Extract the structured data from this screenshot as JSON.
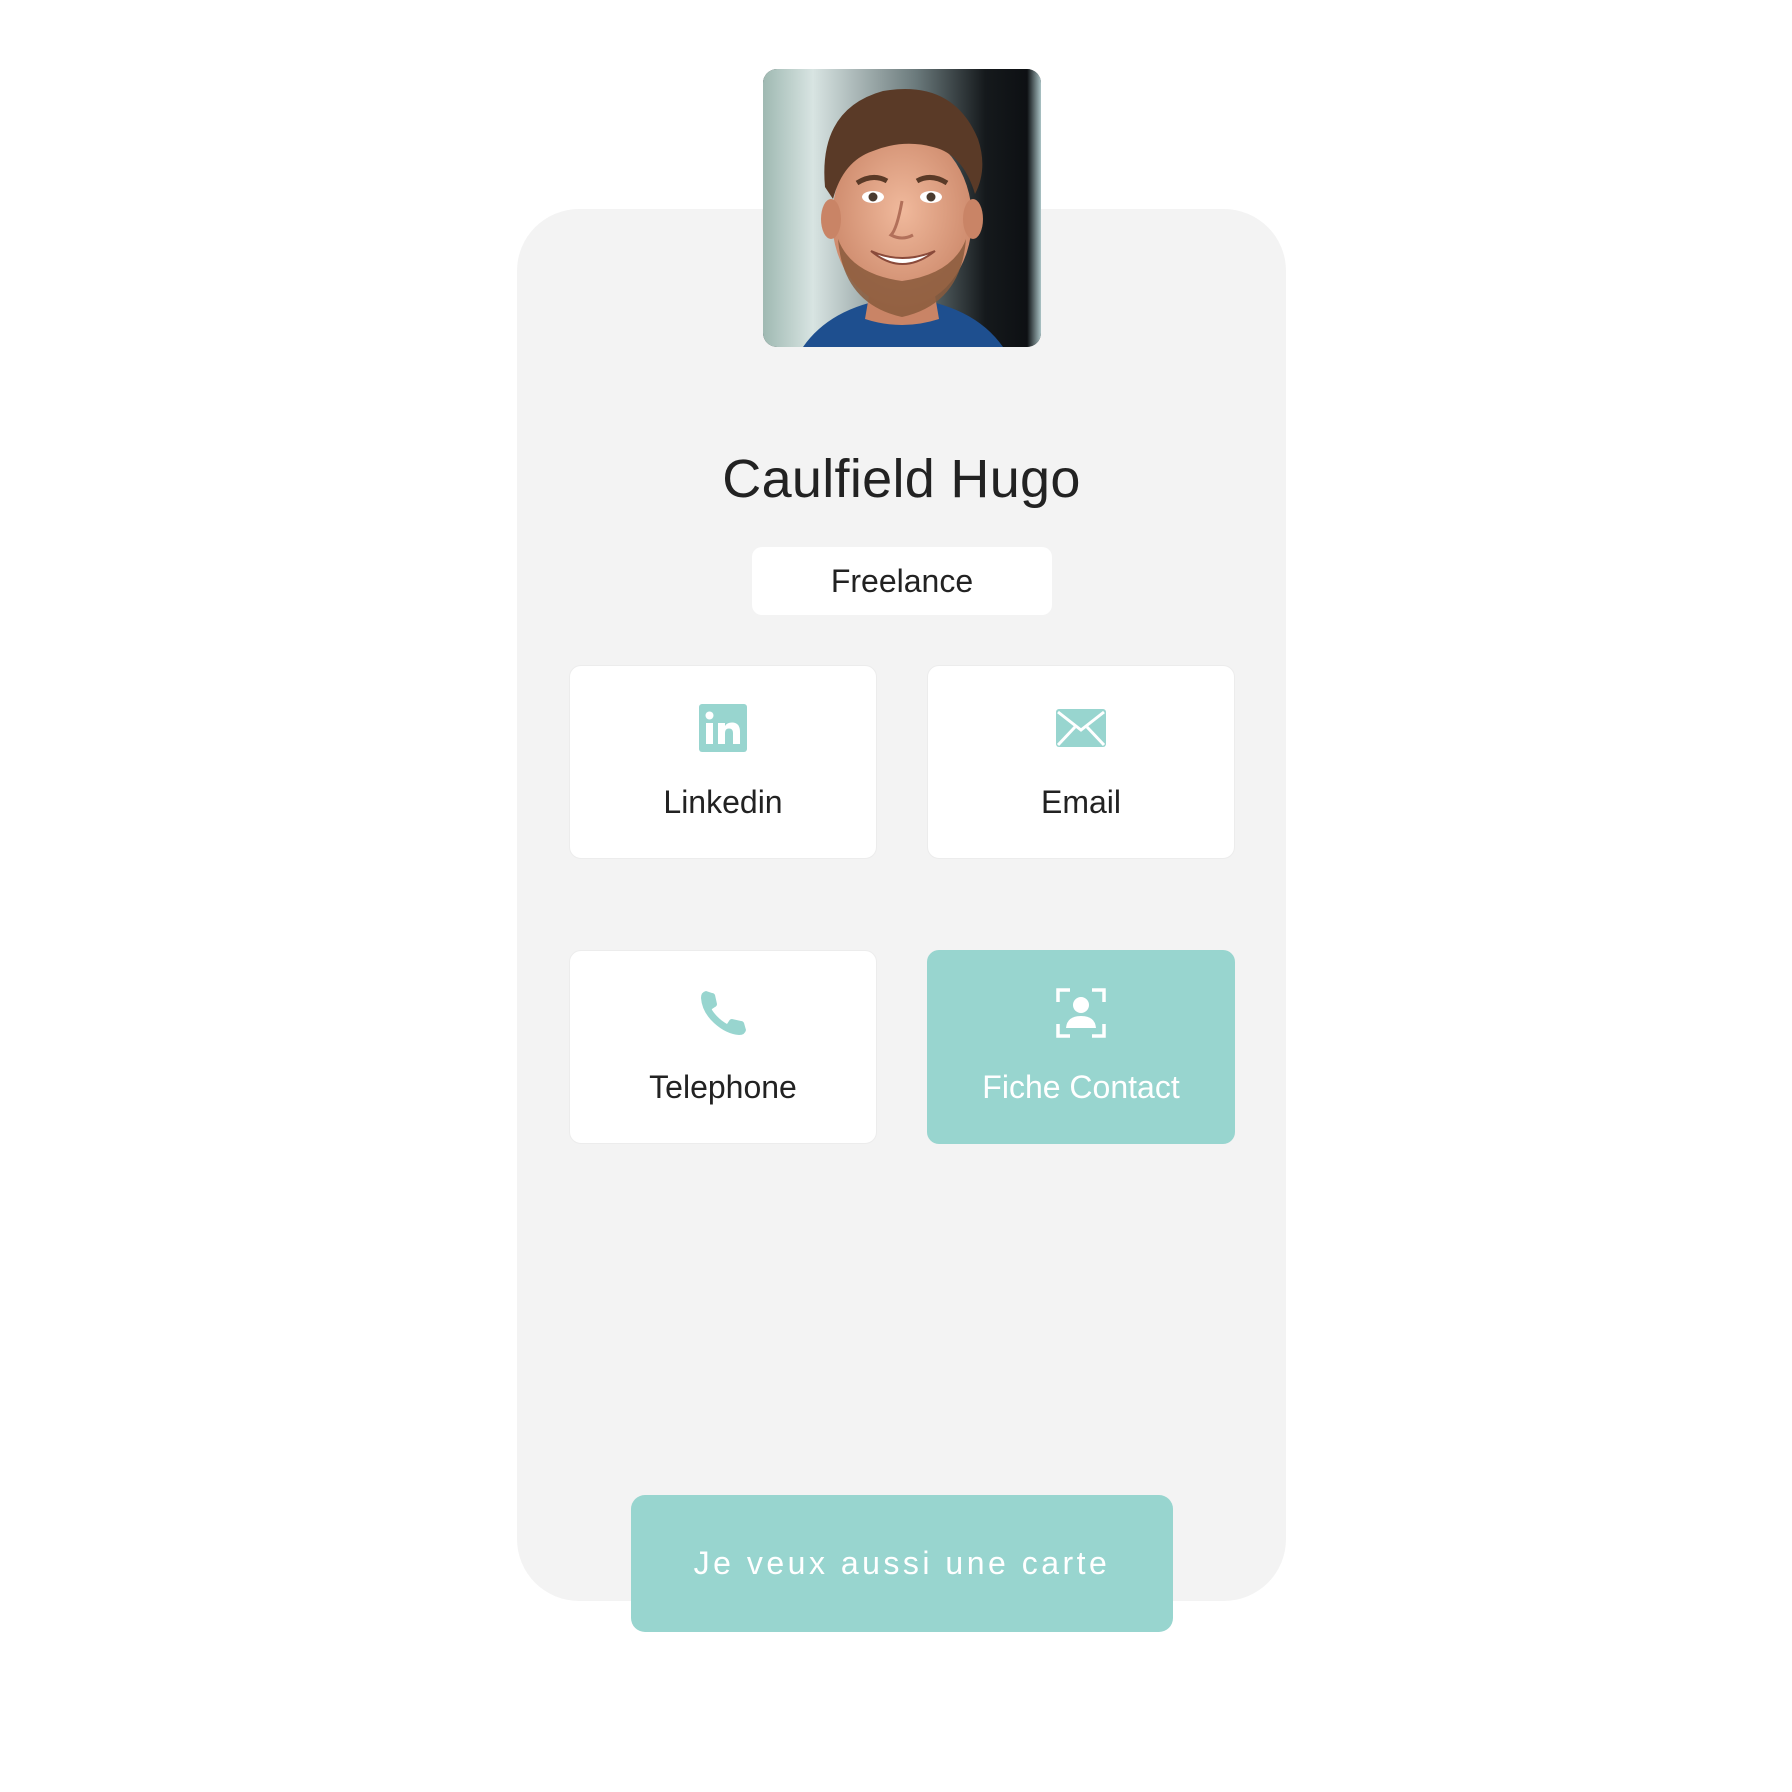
{
  "colors": {
    "accent": "#98d5cf",
    "card_bg": "#f3f3f3",
    "text": "#222222"
  },
  "profile": {
    "name": "Caulfield Hugo",
    "tag": "Freelance",
    "photo_icon": "profile-photo"
  },
  "actions": [
    {
      "label": "Linkedin",
      "icon": "linkedin-icon"
    },
    {
      "label": "Email",
      "icon": "envelope-icon"
    },
    {
      "label": "Telephone",
      "icon": "phone-icon"
    },
    {
      "label": "Fiche Contact",
      "icon": "contact-card-icon"
    }
  ],
  "cta": {
    "label": "Je veux aussi une carte"
  }
}
